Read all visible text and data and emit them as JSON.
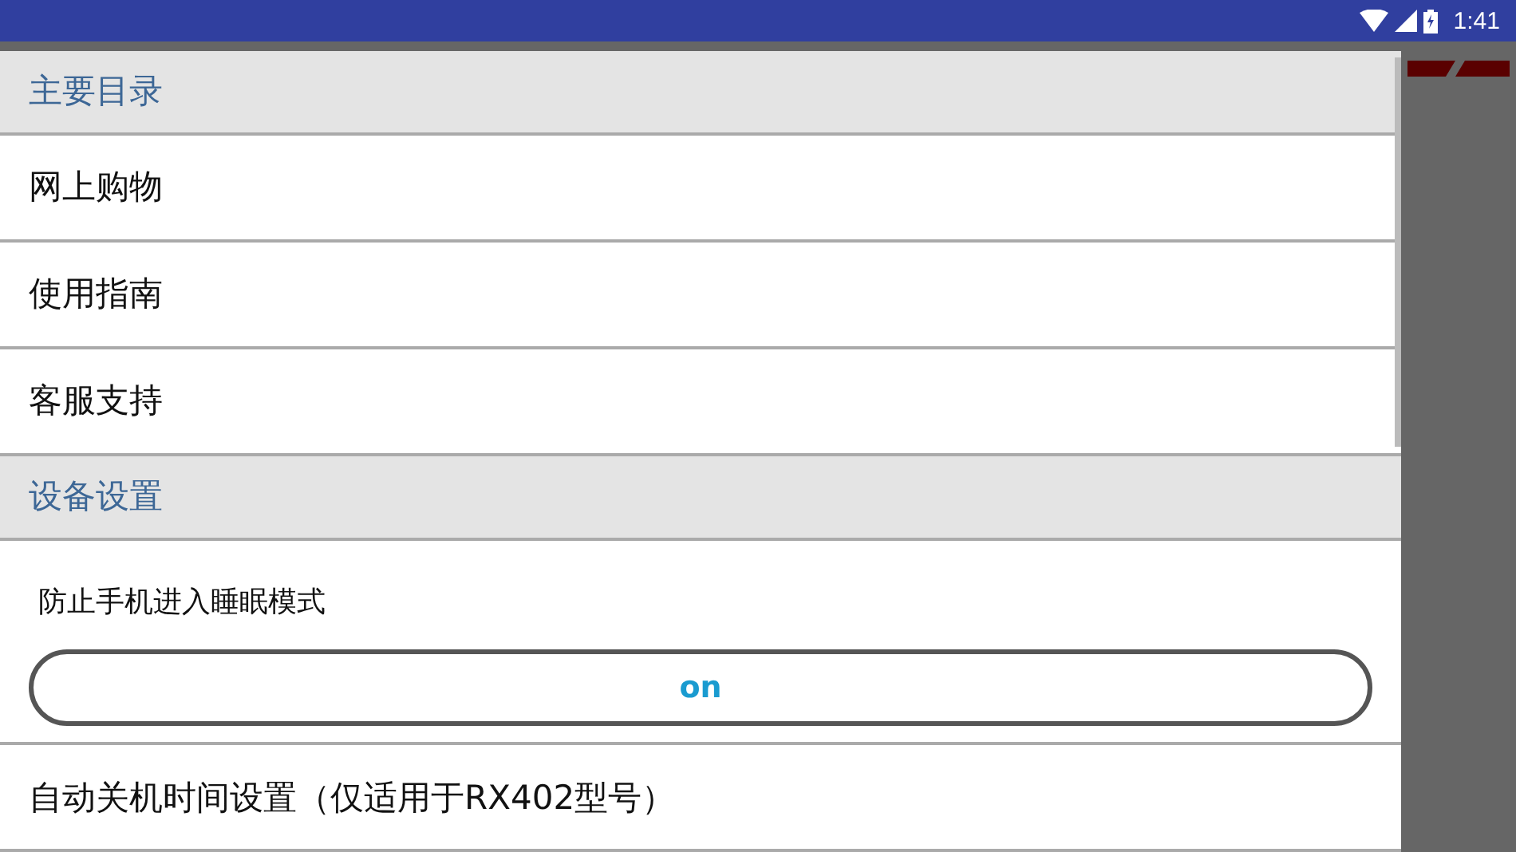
{
  "status_bar": {
    "time": "1:41"
  },
  "drawer": [
    {
      "kind": "header",
      "label": "主要目录"
    },
    {
      "kind": "item",
      "label": "网上购物"
    },
    {
      "kind": "item",
      "label": "使用指南"
    },
    {
      "kind": "item",
      "label": "客服支持"
    },
    {
      "kind": "header",
      "label": "设备设置"
    },
    {
      "kind": "switch",
      "label": "防止手机进入睡眠模式",
      "value": "on",
      "on": true
    },
    {
      "kind": "item",
      "label": "自动关机时间设置（仅适用于RX402型号）"
    }
  ]
}
